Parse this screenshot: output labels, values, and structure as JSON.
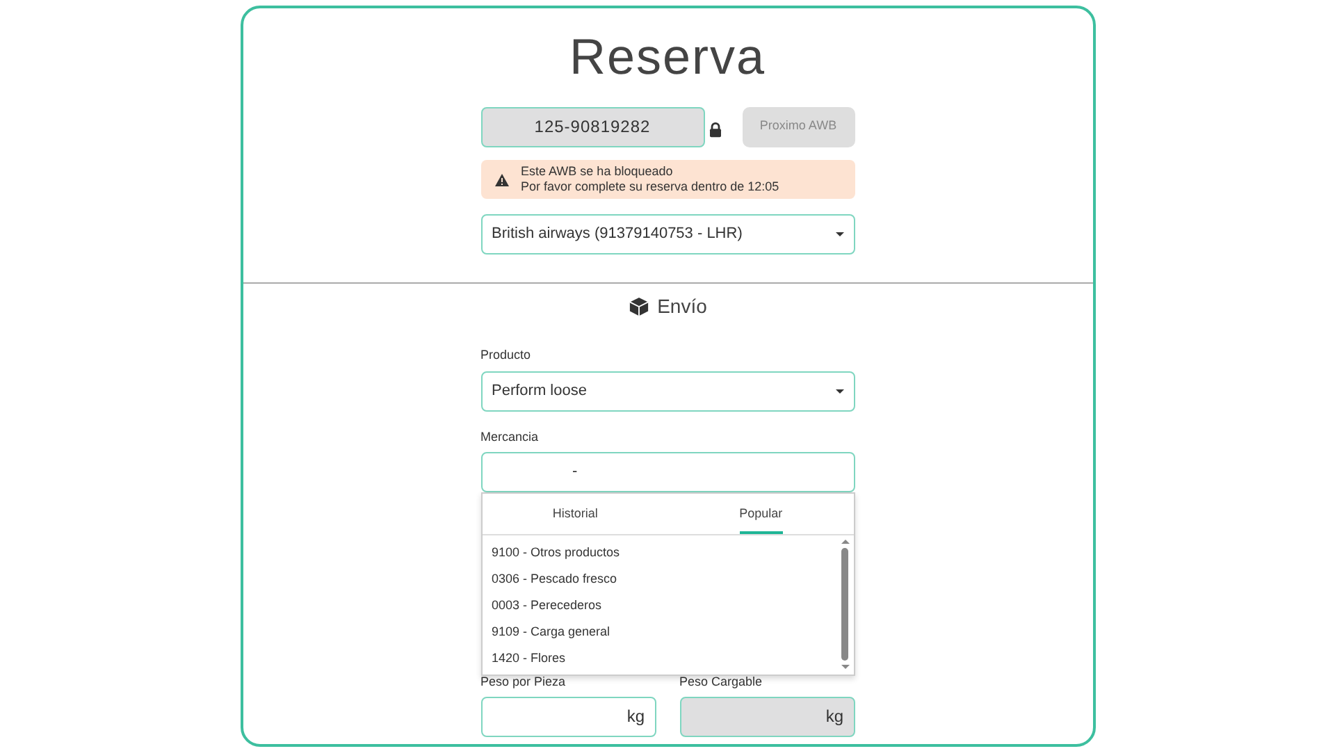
{
  "title": "Reserva",
  "awb": {
    "value": "125-90819282",
    "locked": true,
    "disabled": true
  },
  "next_button": {
    "label": "Proximo AWB",
    "disabled": true
  },
  "alert": {
    "lines": [
      "Este AWB se ha bloqueado",
      "Por favor complete su reserva dentro de 12:05"
    ]
  },
  "airline_select": {
    "value": "British airways (91379140753 - LHR)"
  },
  "section": {
    "title": "Envío"
  },
  "producto": {
    "label": "Producto",
    "value": "Perform loose"
  },
  "mercancia": {
    "label": "Mercancia",
    "value": "-",
    "expanded": true
  },
  "dropdown": {
    "tabs": [
      {
        "label": "Historial",
        "selected": false
      },
      {
        "label": "Popular",
        "selected": true
      }
    ],
    "items": [
      "9100 - Otros productos",
      "0306 - Pescado fresco",
      "0003 - Perecederos",
      "9109 - Carga general",
      "1420 - Flores"
    ]
  },
  "weights": [
    {
      "label": "Peso por Pieza",
      "unit": "kg",
      "disabled": false
    },
    {
      "label": "Peso Cargable",
      "unit": "kg",
      "disabled": true
    }
  ]
}
